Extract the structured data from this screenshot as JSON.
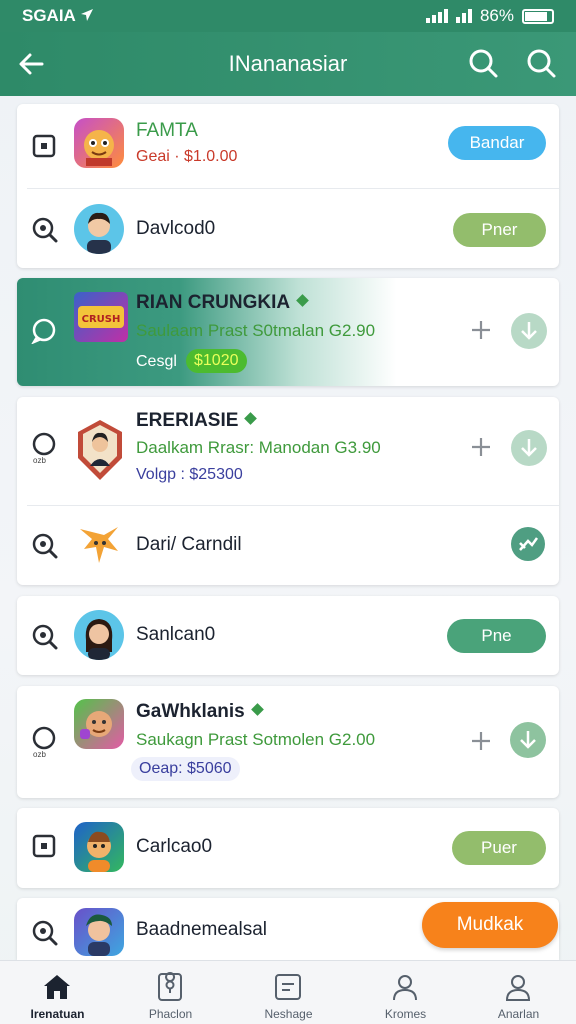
{
  "status": {
    "time": "SGAIA",
    "battery_text": "86%"
  },
  "appbar": {
    "title": "INananasiar"
  },
  "rows": [
    {
      "name": "FAMTA",
      "price": "Geai · $1.0.00",
      "button": "Bandar"
    },
    {
      "name": "Davlcod0",
      "button": "Pner"
    },
    {
      "name": "RIAN CRUNGKIA",
      "detail": "Saulaam Prast S0tmalan G2.90",
      "tag": "Cesgl",
      "badge": "$1020",
      "logo_text": "CRUSH"
    },
    {
      "name": "ERERIASIE",
      "detail": "Daalkam Rrasr: Manodan G3.90",
      "tag": "Volgp : $25300",
      "tiny": "ozb"
    },
    {
      "name": "Dari/ Carndil"
    },
    {
      "name": "Sanlcan0",
      "button": "Pne"
    },
    {
      "name": "GaWhklanis",
      "detail": "Saukagn Prast Sotmolen G2.00",
      "chip": "Oeap: $5060",
      "tiny": "ozb"
    },
    {
      "name": "Carlcao0",
      "button": "Puer"
    },
    {
      "name": "Baadnemealsal",
      "button": "Mudkak"
    }
  ],
  "nav": [
    {
      "label": "Irenatuan",
      "icon": "home-icon"
    },
    {
      "label": "Phaclon",
      "icon": "location-card-icon"
    },
    {
      "label": "Neshage",
      "icon": "message-box-icon"
    },
    {
      "label": "Kromes",
      "icon": "person-icon"
    },
    {
      "label": "Anarlan",
      "icon": "account-icon"
    }
  ],
  "colors": {
    "primary": "#2f8a68",
    "blue_button": "#46b6ee",
    "light_green_button": "#93bd6c",
    "green_button": "#4aa37a",
    "orange_button": "#f7821b",
    "price_red": "#c93a2a"
  }
}
